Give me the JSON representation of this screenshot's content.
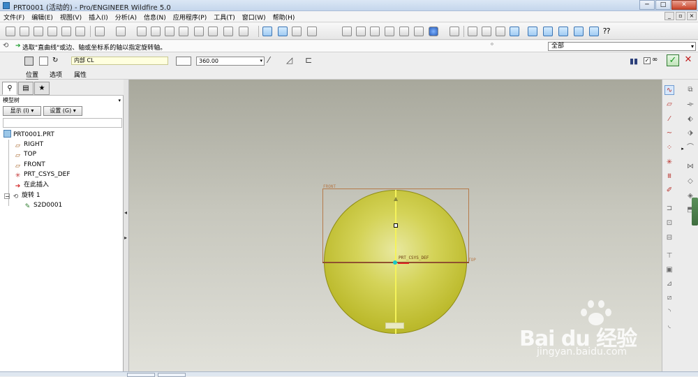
{
  "window": {
    "title": "PRT0001 (活动的) - Pro/ENGINEER Wildfire 5.0",
    "minimize": "─",
    "maximize": "□",
    "close": "✕"
  },
  "menu": [
    "文件(F)",
    "编辑(E)",
    "视图(V)",
    "插入(I)",
    "分析(A)",
    "信息(N)",
    "应用程序(P)",
    "工具(T)",
    "窗口(W)",
    "帮助(H)"
  ],
  "message": {
    "text": "选取\"直曲线\"或边、轴或坐标系的轴以指定旋转轴。"
  },
  "filter": {
    "value": "全部"
  },
  "dashboard": {
    "axis_value": "内部 CL",
    "angle_value": "360.00",
    "pause": "▮▮",
    "ok": "✓",
    "cancel": "✕"
  },
  "subtabs": [
    "位置",
    "选项",
    "属性"
  ],
  "left_panel": {
    "header": "模型树",
    "display_btn": "显示 (I) ▾",
    "settings_btn": "设置 (G) ▾",
    "tree": [
      {
        "label": "PRT0001.PRT",
        "icon": "part-icon"
      },
      {
        "label": "RIGHT",
        "icon": "datum-plane-icon"
      },
      {
        "label": "TOP",
        "icon": "datum-plane-icon"
      },
      {
        "label": "FRONT",
        "icon": "datum-plane-icon"
      },
      {
        "label": "PRT_CSYS_DEF",
        "icon": "csys-icon"
      },
      {
        "label": "在此插入",
        "icon": "insert-here-icon"
      },
      {
        "label": "旋转 1",
        "icon": "revolve-icon"
      },
      {
        "label": "S2D0001",
        "icon": "sketch-icon"
      }
    ]
  },
  "viewport": {
    "label_front": "FRONT",
    "label_top": "TOP",
    "label_csys": "PRT_CSYS_DEF"
  },
  "watermark": {
    "brand": "Bai du 经验",
    "url": "jingyan.baidu.com"
  },
  "colors": {
    "sphere": "#d4d358",
    "datum": "#b57a4a",
    "accept": "#16961f"
  }
}
